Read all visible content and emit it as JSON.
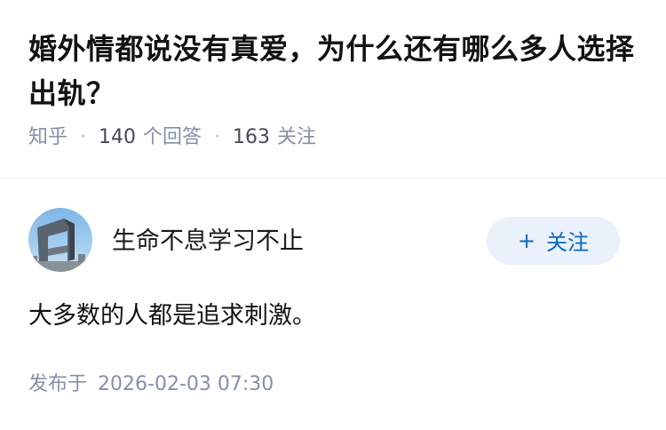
{
  "question": {
    "title": "婚外情都说没有真爱，为什么还有哪么多人选择出轨？",
    "source": "知乎",
    "answer_count": "140",
    "answer_label": "个回答",
    "follower_count": "163",
    "follower_label": "关注"
  },
  "author": {
    "name": "生命不息学习不止",
    "follow_label": "关注",
    "follow_icon": "plus-icon"
  },
  "answer": {
    "text": "大多数的人都是追求刺激。"
  },
  "post": {
    "label": "发布于",
    "timestamp": "2026-02-03 07:30"
  },
  "colors": {
    "accent": "#0a66c2",
    "follow_bg": "#eaf1fb",
    "meta": "#8590a6",
    "text": "#121212"
  }
}
